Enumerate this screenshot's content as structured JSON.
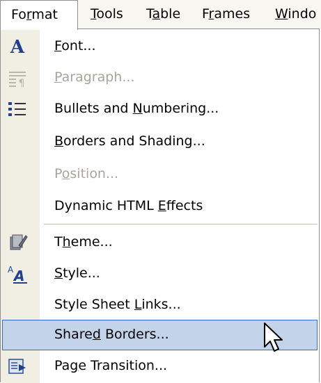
{
  "menubar": {
    "items": [
      {
        "pre": "Fo",
        "key": "r",
        "post": "mat"
      },
      {
        "pre": "",
        "key": "T",
        "post": "ools"
      },
      {
        "pre": "T",
        "key": "a",
        "post": "ble"
      },
      {
        "pre": "F",
        "key": "r",
        "post": "ames"
      },
      {
        "pre": "",
        "key": "W",
        "post": "indo"
      }
    ]
  },
  "menu": {
    "items": [
      {
        "pre": "",
        "key": "F",
        "post": "ont...",
        "icon": "font-icon",
        "disabled": false,
        "highlighted": false
      },
      {
        "pre": "",
        "key": "P",
        "post": "aragraph...",
        "icon": "paragraph-icon",
        "disabled": true,
        "highlighted": false
      },
      {
        "pre": "Bullets and ",
        "key": "N",
        "post": "umbering...",
        "icon": "bullets-icon",
        "disabled": false,
        "highlighted": false
      },
      {
        "pre": "",
        "key": "B",
        "post": "orders and Shading...",
        "icon": "",
        "disabled": false,
        "highlighted": false
      },
      {
        "pre": "P",
        "key": "o",
        "post": "sition...",
        "icon": "",
        "disabled": true,
        "highlighted": false
      },
      {
        "pre": "Dynamic HTML ",
        "key": "E",
        "post": "ffects",
        "icon": "",
        "disabled": false,
        "highlighted": false
      },
      {
        "pre": "T",
        "key": "h",
        "post": "eme...",
        "icon": "theme-icon",
        "disabled": false,
        "highlighted": false
      },
      {
        "pre": "",
        "key": "S",
        "post": "tyle...",
        "icon": "style-icon",
        "disabled": false,
        "highlighted": false
      },
      {
        "pre": "Style Sheet ",
        "key": "L",
        "post": "inks...",
        "icon": "",
        "disabled": false,
        "highlighted": false
      },
      {
        "pre": "Share",
        "key": "d",
        "post": " Borders...",
        "icon": "",
        "disabled": false,
        "highlighted": true
      },
      {
        "pre": "Pa",
        "key": "g",
        "post": "e Transition...",
        "icon": "page-transition-icon",
        "disabled": false,
        "highlighted": false
      }
    ]
  },
  "colors": {
    "highlight_bg": "#c2d3ea",
    "highlight_border": "#316ac5",
    "disabled_text": "#a7a59c",
    "icon_strip": "#f1efe4",
    "menubar_bg": "#f7f6f1"
  }
}
